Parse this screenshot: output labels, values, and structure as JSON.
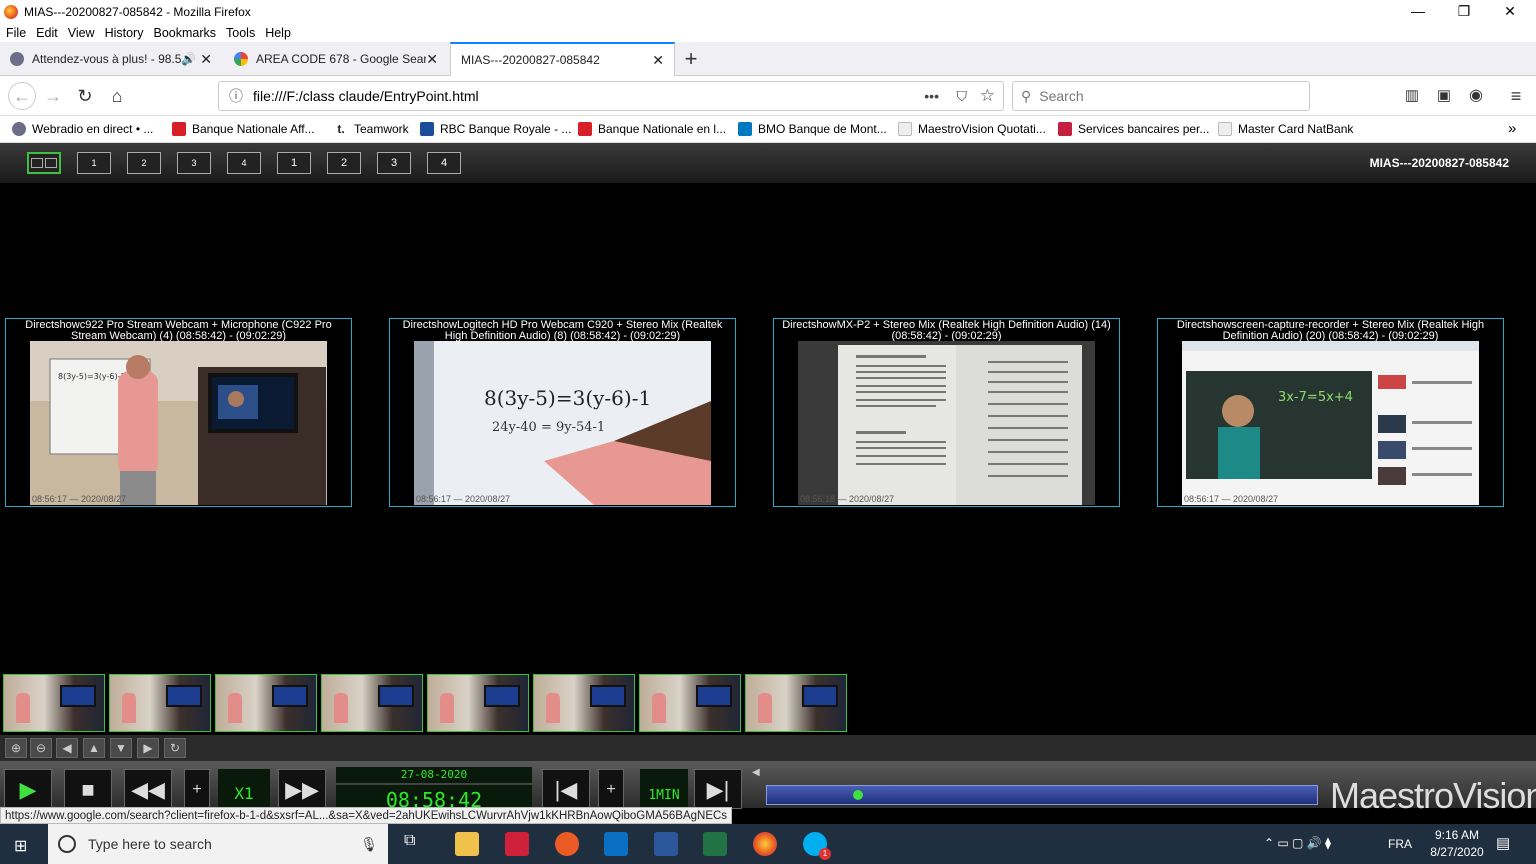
{
  "window": {
    "title": "MIAS---20200827-085842 - Mozilla Firefox",
    "minimize": "—",
    "maximize": "❐",
    "close": "✕"
  },
  "menu": [
    "File",
    "Edit",
    "View",
    "History",
    "Bookmarks",
    "Tools",
    "Help"
  ],
  "tabs": [
    {
      "label": "Attendez-vous à plus! - 98.5",
      "icon_color": "#6d6d8a",
      "has_audio": true
    },
    {
      "label": "AREA CODE 678 - Google Sear",
      "icon_color": "#4285f4",
      "has_audio": false
    },
    {
      "label": "MIAS---20200827-085842",
      "icon_color": "",
      "has_audio": false
    }
  ],
  "new_tab": "+",
  "nav": {
    "url": "file:///F:/class claude/EntryPoint.html",
    "search_placeholder": "Search",
    "page_actions": "•••"
  },
  "bookmarks": [
    {
      "label": "Webradio en direct • ...",
      "color": "#6d6d8a"
    },
    {
      "label": "Banque Nationale Aff...",
      "color": "#d61f26"
    },
    {
      "label": "Teamwork",
      "color": "#222222"
    },
    {
      "label": "RBC Banque Royale - ...",
      "color": "#1c4c9c"
    },
    {
      "label": "Banque Nationale en l...",
      "color": "#d61f26"
    },
    {
      "label": "BMO Banque de Mont...",
      "color": "#0079c1"
    },
    {
      "label": "MaestroVision Quotati...",
      "color": "#bbbbbb"
    },
    {
      "label": "Services bancaires per...",
      "color": "#c41f3e"
    },
    {
      "label": "Master Card NatBank",
      "color": "#bbbbbb"
    }
  ],
  "app": {
    "doc_title": "MIAS---20200827-085842",
    "layout_buttons": [
      "",
      "1",
      "2",
      "3",
      "4",
      "1",
      "2",
      "3",
      "4"
    ]
  },
  "panels": [
    {
      "caption": "Directshowc922 Pro Stream Webcam + Microphone (C922 Pro Stream Webcam) (4) (08:58:42) - (09:02:29)",
      "timestamp": "08:56:17 — 2020/08/27"
    },
    {
      "caption": "DirectshowLogitech HD Pro Webcam C920 + Stereo Mix (Realtek High Definition Audio) (8) (08:58:42) - (09:02:29)",
      "timestamp": "08:56:17 — 2020/08/27"
    },
    {
      "caption": "DirectshowMX-P2 + Stereo Mix (Realtek High Definition Audio) (14) (08:58:42) - (09:02:29)",
      "timestamp": "08:56:18 — 2020/08/27"
    },
    {
      "caption": "Directshowscreen-capture-recorder + Stereo Mix (Realtek High Definition Audio) (20) (08:58:42) - (09:02:29)",
      "timestamp": "08:56:17 — 2020/08/27"
    }
  ],
  "whiteboard_text": {
    "line1": "8(3y-5)=3(y-6)-1",
    "line2": "24y-40 = 9y-54-1",
    "line3": "3x-7=5x+4"
  },
  "thumbnails_count": 8,
  "player": {
    "date": "27-08-2020",
    "time": "08:58:42",
    "speed": "X1",
    "mode": "1MIN",
    "progress": 0.16,
    "brand": "MaestroVision"
  },
  "status_url": "https://www.google.com/search?client=firefox-b-1-d&sxsrf=AL...&sa=X&ved=2ahUKEwihsLCWurvrAhVjw1kKHRBnAowQiboGMA56BAgNECs",
  "taskbar": {
    "search_placeholder": "Type here to search",
    "lang": "FRA",
    "time": "9:16 AM",
    "date": "8/27/2020",
    "skype_badge": "1"
  }
}
